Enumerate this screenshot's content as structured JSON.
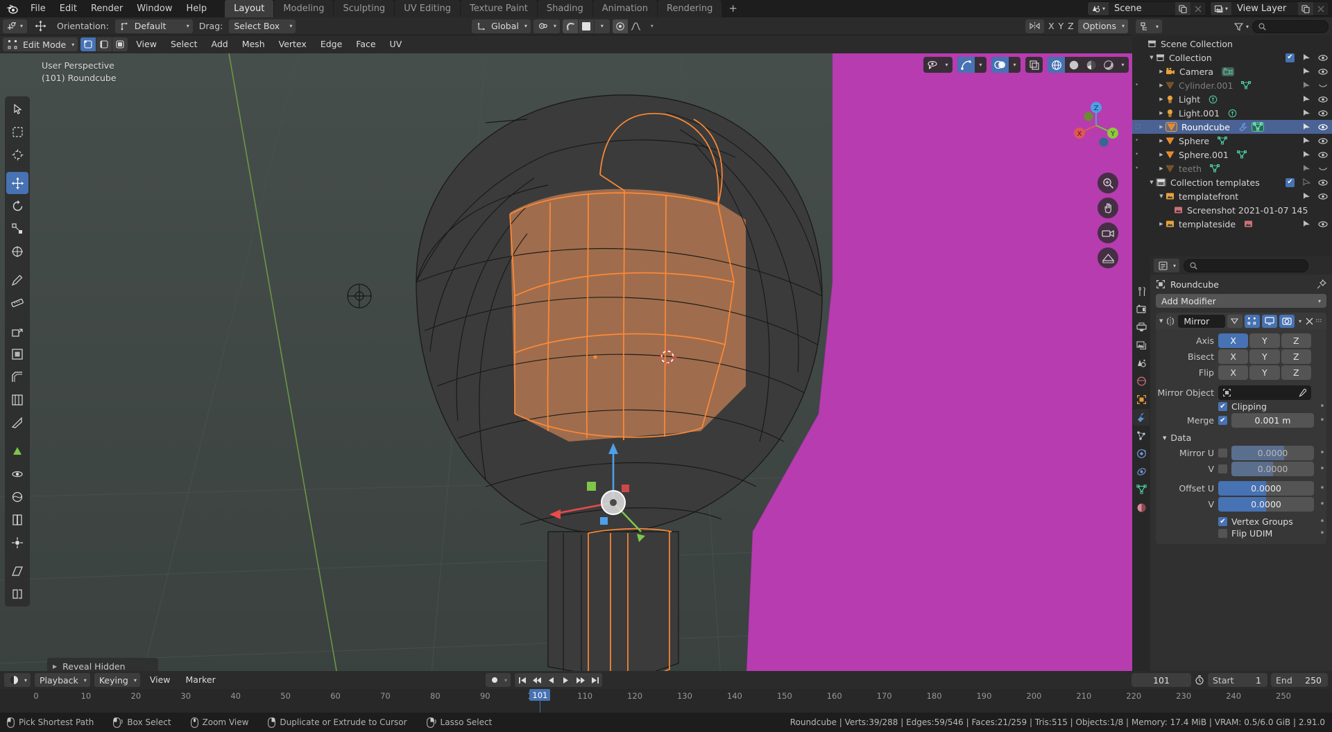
{
  "app": {
    "topbar_menus": [
      "File",
      "Edit",
      "Render",
      "Window",
      "Help"
    ],
    "workspace_tabs": [
      {
        "label": "Layout",
        "active": true
      },
      {
        "label": "Modeling",
        "active": false
      },
      {
        "label": "Sculpting",
        "active": false
      },
      {
        "label": "UV Editing",
        "active": false
      },
      {
        "label": "Texture Paint",
        "active": false
      },
      {
        "label": "Shading",
        "active": false
      },
      {
        "label": "Animation",
        "active": false
      },
      {
        "label": "Rendering",
        "active": false
      }
    ],
    "add_workspace_label": "+",
    "scene_field": {
      "icon": "scene-icon",
      "value": "Scene",
      "new_label": "copy-icon",
      "unlink_label": "×"
    },
    "viewlayer_field": {
      "icon": "viewlayer-icon",
      "value": "View Layer",
      "new_label": "copy-icon",
      "unlink_label": "×"
    }
  },
  "tool_header": {
    "orientation_label": "Orientation:",
    "orientation_value": "Default",
    "drag_label": "Drag:",
    "drag_value": "Select Box",
    "transform_orientation": "Global",
    "options_label": "Options",
    "axis_letters": [
      "X",
      "Y",
      "Z"
    ]
  },
  "viewport_header": {
    "mode": "Edit Mode",
    "menus": [
      "View",
      "Select",
      "Add",
      "Mesh",
      "Vertex",
      "Edge",
      "Face",
      "UV"
    ],
    "select_modes": [
      "vertex-select",
      "edge-select",
      "face-select"
    ]
  },
  "viewport": {
    "perspective_label": "User Perspective",
    "object_label": "(101) Roundcube",
    "reveal_hidden_label": "Reveal Hidden",
    "gizmo_axes": [
      "X",
      "Y",
      "Z"
    ],
    "background_color": "#3f4746",
    "template_plane_color": "#b63cb0",
    "selection_color": "#ff8936",
    "active_face_color": "#a8724f"
  },
  "outliner": {
    "root": "Scene Collection",
    "items": [
      {
        "label": "Collection",
        "depth": 1,
        "type": "collection",
        "expanded": true,
        "checkbox": true,
        "selectable": true,
        "visible": true,
        "dim": false
      },
      {
        "label": "Camera",
        "depth": 2,
        "type": "camera",
        "expanded": false,
        "datablock": "camera-data",
        "visible": true,
        "dim": false
      },
      {
        "label": "Cylinder.001",
        "depth": 2,
        "type": "mesh",
        "expanded": false,
        "datablock": "mesh-data",
        "visible": false,
        "dim": true
      },
      {
        "label": "Light",
        "depth": 2,
        "type": "light",
        "expanded": false,
        "datablock": "light-data",
        "visible": true,
        "dim": false
      },
      {
        "label": "Light.001",
        "depth": 2,
        "type": "light",
        "expanded": false,
        "datablock": "light-data",
        "visible": true,
        "dim": false
      },
      {
        "label": "Roundcube",
        "depth": 2,
        "type": "mesh",
        "expanded": false,
        "datablock": "mesh-data",
        "modifier": true,
        "visible": true,
        "dim": false,
        "selected": true
      },
      {
        "label": "Sphere",
        "depth": 2,
        "type": "mesh",
        "expanded": false,
        "datablock": "mesh-data",
        "visible": true,
        "dim": false
      },
      {
        "label": "Sphere.001",
        "depth": 2,
        "type": "mesh",
        "expanded": false,
        "datablock": "mesh-data",
        "visible": true,
        "dim": false
      },
      {
        "label": "teeth",
        "depth": 2,
        "type": "mesh",
        "expanded": false,
        "datablock": "mesh-data",
        "visible": false,
        "dim": true
      },
      {
        "label": "Collection templates",
        "depth": 1,
        "type": "collection",
        "expanded": true,
        "checkbox": true,
        "visible": true,
        "dim": false
      },
      {
        "label": "templatefront",
        "depth": 2,
        "type": "image",
        "expanded": true,
        "visible": true,
        "dim": false
      },
      {
        "label": "Screenshot 2021-01-07 145",
        "depth": 3,
        "type": "image-data",
        "expanded": false,
        "visible": true,
        "dim": false
      },
      {
        "label": "templateside",
        "depth": 2,
        "type": "image",
        "expanded": false,
        "datablock": "image-data",
        "visible": true,
        "dim": false
      }
    ],
    "search_placeholder": ""
  },
  "properties": {
    "object_name": "Roundcube",
    "add_modifier_label": "Add Modifier",
    "pin_icon": "pin-icon",
    "tabs": [
      {
        "name": "tool-tab",
        "icon": "wrench-screwdriver-icon",
        "active": false
      },
      {
        "name": "render-tab",
        "icon": "camera-back-icon",
        "active": false
      },
      {
        "name": "output-tab",
        "icon": "printer-icon",
        "active": false
      },
      {
        "name": "view-layer-tab",
        "icon": "images-icon",
        "active": false
      },
      {
        "name": "scene-tab",
        "icon": "cone-sphere-icon",
        "active": false
      },
      {
        "name": "world-tab",
        "icon": "world-icon",
        "active": false
      },
      {
        "name": "object-tab",
        "icon": "orange-square-icon",
        "active": false
      },
      {
        "name": "modifier-tab",
        "icon": "wrench-icon",
        "active": true
      },
      {
        "name": "particles-tab",
        "icon": "particles-icon",
        "active": false
      },
      {
        "name": "physics-tab",
        "icon": "physics-icon",
        "active": false
      },
      {
        "name": "constraints-tab",
        "icon": "constraint-icon",
        "active": false
      },
      {
        "name": "data-tab",
        "icon": "green-triangle-icon",
        "active": false
      },
      {
        "name": "material-tab",
        "icon": "material-sphere-icon",
        "active": false
      }
    ],
    "modifier": {
      "name": "Mirror",
      "display_toggles": [
        "edit-mode-on-cage",
        "edit-mode",
        "realtime",
        "render"
      ],
      "axis_label": "Axis",
      "axis_values": [
        "X",
        "Y",
        "Z"
      ],
      "axis_active": [
        "X"
      ],
      "bisect_label": "Bisect",
      "bisect_values": [
        "X",
        "Y",
        "Z"
      ],
      "bisect_active": [],
      "flip_label": "Flip",
      "flip_values": [
        "X",
        "Y",
        "Z"
      ],
      "flip_active": [],
      "mirror_object_label": "Mirror Object",
      "mirror_object_value": "",
      "clipping_label": "Clipping",
      "clipping_checked": true,
      "merge_label": "Merge",
      "merge_checked": true,
      "merge_value": "0.001 m",
      "data_section_label": "Data",
      "mirror_u_label": "Mirror U",
      "mirror_u_checked": false,
      "mirror_u_value": "0.0000",
      "mirror_v_label": "V",
      "mirror_v_checked": false,
      "mirror_v_value": "0.0000",
      "offset_u_label": "Offset U",
      "offset_u_value": "0.0000",
      "offset_v_label": "V",
      "offset_v_value": "0.0000",
      "vertex_groups_label": "Vertex Groups",
      "vertex_groups_checked": true,
      "flip_udim_label": "Flip UDIM",
      "flip_udim_checked": false
    }
  },
  "timeline": {
    "menus": [
      "Playback",
      "Keying",
      "View",
      "Marker"
    ],
    "current_frame": "101",
    "start_label": "Start",
    "start_value": "1",
    "end_label": "End",
    "end_value": "250",
    "ticks": [
      0,
      10,
      20,
      30,
      40,
      50,
      60,
      70,
      80,
      90,
      100,
      110,
      120,
      130,
      140,
      150,
      160,
      170,
      180,
      190,
      200,
      210,
      220,
      230,
      240,
      250
    ],
    "playhead_frame": 101
  },
  "statusbar": {
    "hints": [
      {
        "icon": "mouse-left-icon",
        "label": "Pick Shortest Path"
      },
      {
        "icon": "mouse-left-drag-icon",
        "label": "Box Select"
      },
      {
        "icon": "mouse-middle-icon",
        "label": "Zoom View"
      },
      {
        "icon": "mouse-right-icon",
        "label": "Duplicate or Extrude to Cursor"
      },
      {
        "icon": "mouse-right-drag-icon",
        "label": "Lasso Select"
      }
    ],
    "stats": "Roundcube | Verts:39/288 | Edges:59/546 | Faces:21/259 | Tris:515 | Objects:1/8 | Memory: 17.4 MiB | VRAM: 0.5/6.0 GiB | 2.91.0"
  }
}
